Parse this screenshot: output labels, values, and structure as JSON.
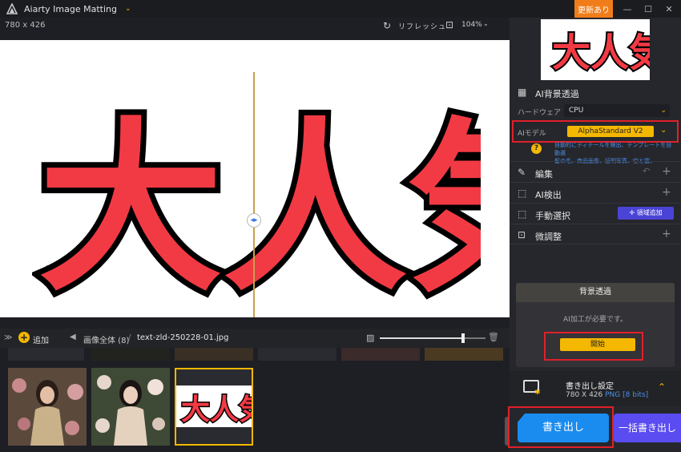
{
  "titlebar": {
    "title": "Aiarty Image Matting",
    "update_label": "更新あり",
    "minimize": "—",
    "maximize": "☐",
    "close": "✕"
  },
  "canvas": {
    "dims": "780 x 426",
    "refresh_label": "リフレッシュ",
    "zoom": "104%",
    "art_text": "大人気!"
  },
  "gallery": {
    "add_label": "追加",
    "crumb_all": "画像全体 (8)",
    "crumb_sep": "/",
    "crumb_file": "text-zld-250228-01.jpg",
    "slider_value": 0.79
  },
  "right": {
    "ai_bg_section": "AI背景透過",
    "hardware_label": "ハードウェア",
    "hardware_value": "CPU",
    "model_label": "AIモデル",
    "model_value": "AlphaStandard  V2",
    "info_line1": "自動的にディテールを検出、テンプレートを自動選",
    "info_line2": "髪の毛、商品画像、証明写真、空と雲。",
    "edit_label": "編集",
    "ai_detect_label": "AI検出",
    "manual_label": "手動選択",
    "region_add_label": "領域追加",
    "fine_tune_label": "微調整",
    "bg_card_title": "背景透過",
    "bg_card_msg": "AI加工が必要です。",
    "start_label": "開始",
    "export_settings_title": "書き出し設定",
    "export_dims": "780 X 426",
    "export_format": "PNG",
    "export_bits": "[8 bits]",
    "export_label": "書き出し",
    "batch_export_label": "一括書き出し"
  },
  "colors": {
    "accent": "#f5b800",
    "highlight_frame": "#e0202a",
    "export_blue": "#1a8cf0",
    "batch_purple": "#5a4cf0",
    "art_red": "#f23a44"
  }
}
